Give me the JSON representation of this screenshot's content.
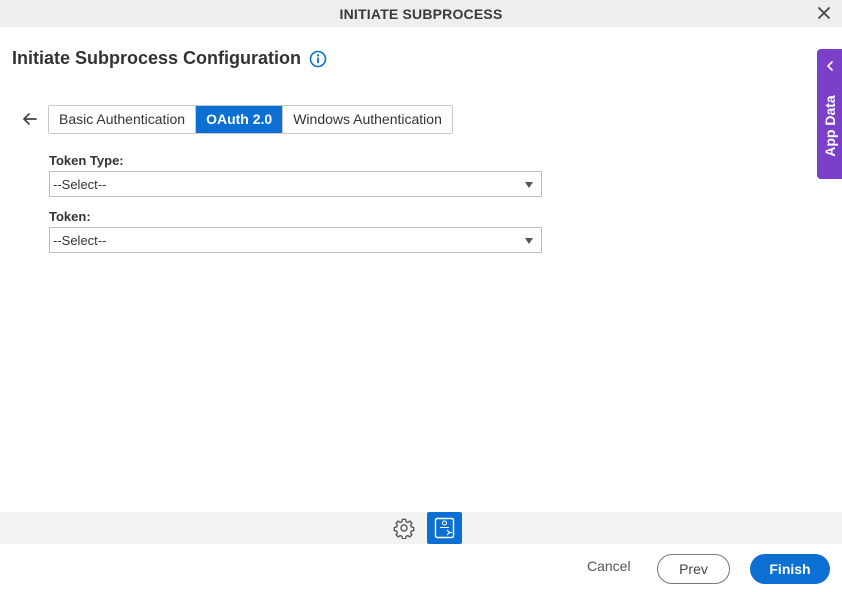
{
  "window": {
    "title": "INITIATE SUBPROCESS",
    "close_icon": "close-icon"
  },
  "header": {
    "title": "Initiate Subprocess Configuration",
    "info_icon": "info-icon"
  },
  "auth_tabs": {
    "back_icon": "arrow-left-icon",
    "tabs": [
      {
        "label": "Basic Authentication",
        "active": false
      },
      {
        "label": "OAuth 2.0",
        "active": true
      },
      {
        "label": "Windows Authentication",
        "active": false
      }
    ]
  },
  "form": {
    "token_type": {
      "label": "Token Type:",
      "value": "--Select--"
    },
    "token": {
      "label": "Token:",
      "value": "--Select--"
    }
  },
  "side_panel": {
    "label": "App Data",
    "icon": "chevron-left-icon"
  },
  "toolbar": {
    "settings_icon": "gear-icon",
    "flow_icon": "process-flow-icon"
  },
  "footer": {
    "cancel_label": "Cancel",
    "prev_label": "Prev",
    "finish_label": "Finish"
  },
  "colors": {
    "accent": "#0c6fd3",
    "side_tab": "#7b3fc9",
    "titlebar": "#eeeeef"
  }
}
